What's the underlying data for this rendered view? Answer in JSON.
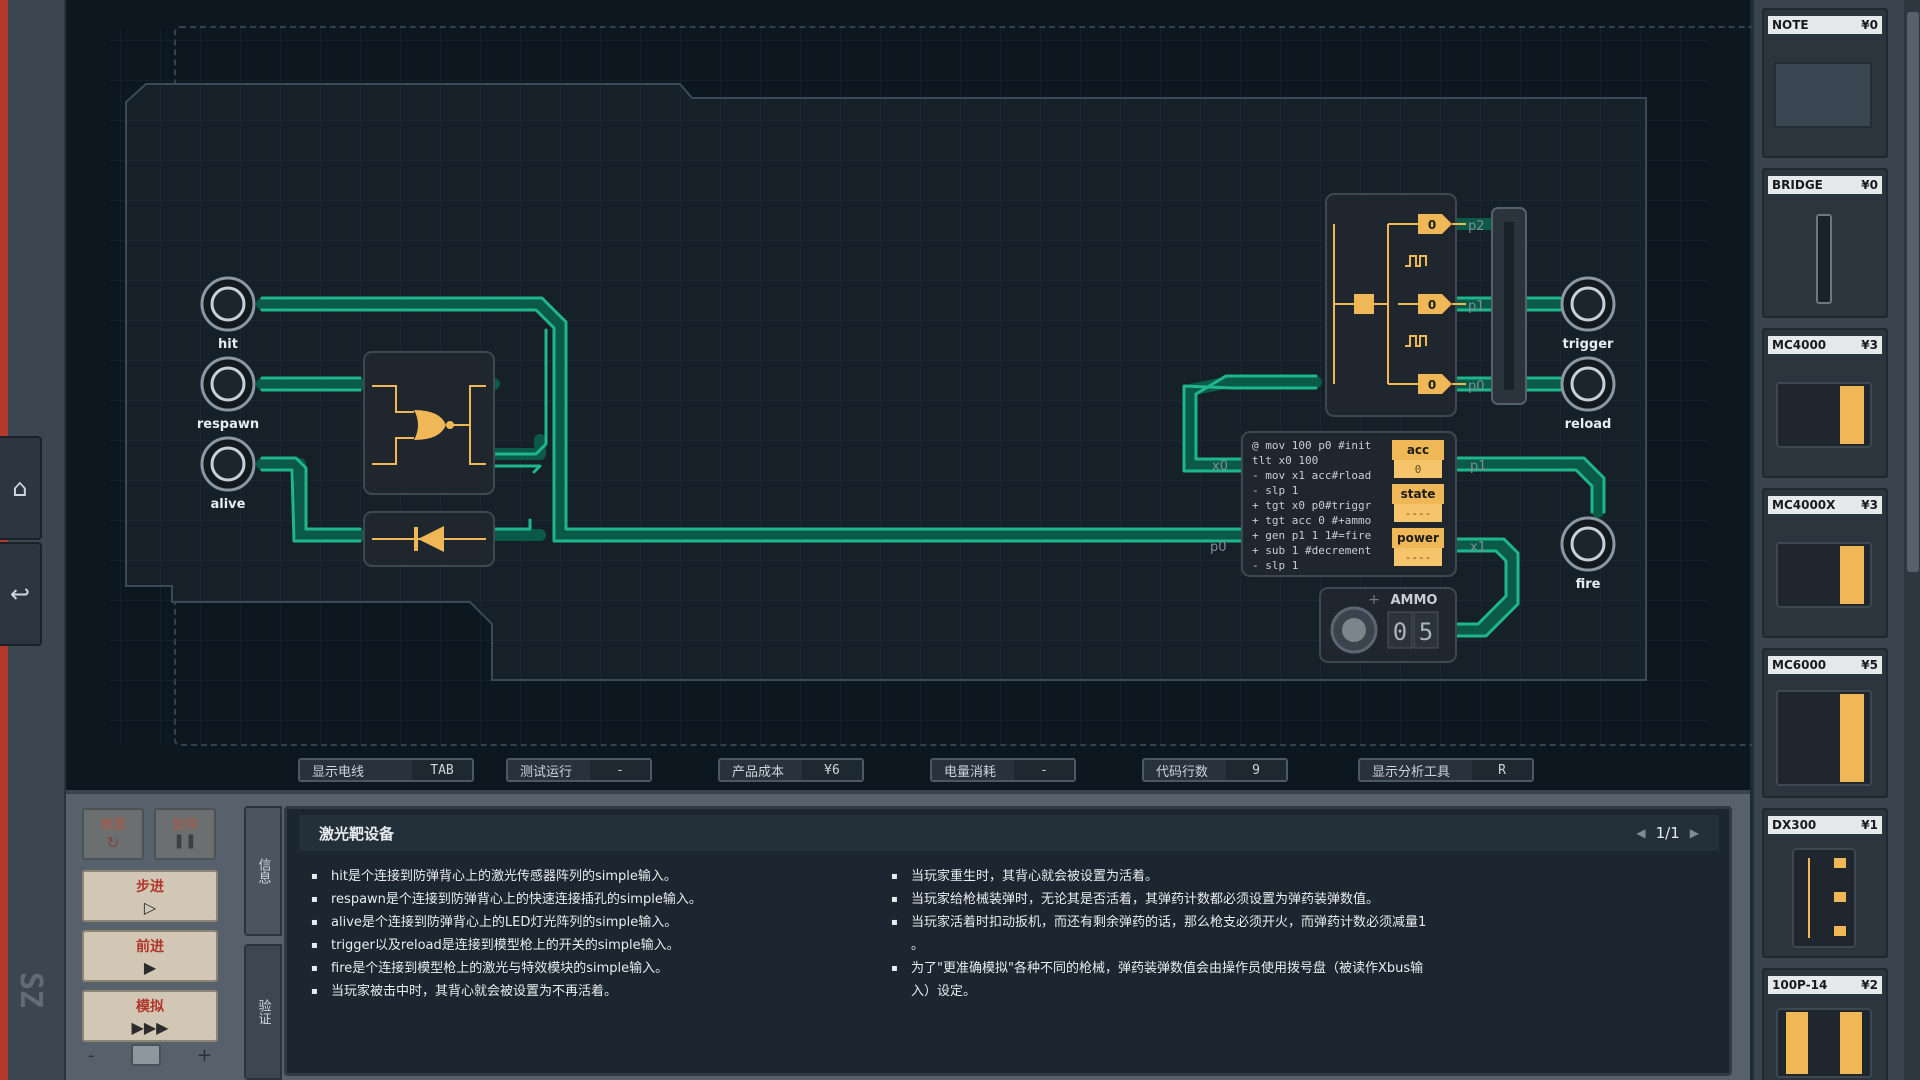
{
  "sidebar_left": {
    "home_icon": "home-icon",
    "back_icon": "undo-arrow-icon",
    "logo_text": "SZ"
  },
  "board": {
    "ports_left": [
      "hit",
      "respawn",
      "alive"
    ],
    "ports_right": [
      "trigger",
      "reload",
      "fire"
    ],
    "mc_pin_labels": {
      "x0": "x0",
      "p0": "p0",
      "p1": "p1",
      "x1": "x1"
    },
    "dx_pin_labels": {
      "p2": "p2",
      "p1": "p1",
      "p0": "p0"
    },
    "dx_outputs": [
      "0",
      "0",
      "0"
    ],
    "code_lines": [
      "@ mov 100 p0 #init",
      "  tlt x0 100",
      "- mov x1 acc#rload",
      "- slp 1",
      "+ tgt x0 p0#triggr",
      "+ tgt acc 0 #+ammo",
      "+ gen p1 1 1#=fire",
      "+ sub 1 #decrement",
      "- slp 1"
    ],
    "registers": [
      {
        "name": "acc",
        "value": "0"
      },
      {
        "name": "state",
        "value": "----"
      },
      {
        "name": "power",
        "value": "----"
      }
    ],
    "ammo": {
      "label": "AMMO",
      "digits": [
        "0",
        "5"
      ],
      "plus": "+"
    }
  },
  "status_bar": [
    {
      "label": "显示电线",
      "value": "TAB"
    },
    {
      "label": "测试运行",
      "value": "-"
    },
    {
      "label": "产品成本",
      "value": "¥6"
    },
    {
      "label": "电量消耗",
      "value": "-"
    },
    {
      "label": "代码行数",
      "value": "9"
    },
    {
      "label": "显示分析工具",
      "value": "R"
    }
  ],
  "controls": {
    "reset": "重置",
    "pause": "暂停",
    "step": "步进",
    "advance": "前进",
    "simulate": "模拟",
    "minus": "-",
    "plus": "+"
  },
  "side_tabs": {
    "info": "信息",
    "verify": "验证"
  },
  "info": {
    "title": "激光靶设备",
    "page": "1/1",
    "left_bullets": [
      "hit是个连接到防弹背心上的激光传感器阵列的simple输入。",
      "respawn是个连接到防弹背心上的快速连接插孔的simple输入。",
      "alive是个连接到防弹背心上的LED灯光阵列的simple输入。",
      "trigger以及reload是连接到模型枪上的开关的simple输入。",
      "fire是个连接到模型枪上的激光与特效模块的simple输入。",
      "当玩家被击中时，其背心就会被设置为不再活着。"
    ],
    "right_bullets": [
      "当玩家重生时，其背心就会被设置为活着。",
      "当玩家给枪械装弹时，无论其是否活着，其弹药计数都必须设置为弹药装弹数值。",
      "当玩家活着时扣动扳机，而还有剩余弹药的话，那么枪支必须开火，而弹药计数必须减量1",
      "。",
      "为了\"更准确模拟\"各种不同的枪械，弹药装弹数值会由操作员使用拨号盘（被读作Xbus输",
      "入）设定。"
    ]
  },
  "palette": [
    {
      "name": "NOTE",
      "price": "¥0"
    },
    {
      "name": "BRIDGE",
      "price": "¥0"
    },
    {
      "name": "MC4000",
      "price": "¥3"
    },
    {
      "name": "MC4000X",
      "price": "¥3"
    },
    {
      "name": "MC6000",
      "price": "¥5"
    },
    {
      "name": "DX300",
      "price": "¥1"
    },
    {
      "name": "100P-14",
      "price": "¥2"
    }
  ],
  "colors": {
    "wire": "#1fb58d",
    "wire_dark": "#0b5a48",
    "chip": "#1f262d",
    "accent": "#f0b757"
  }
}
